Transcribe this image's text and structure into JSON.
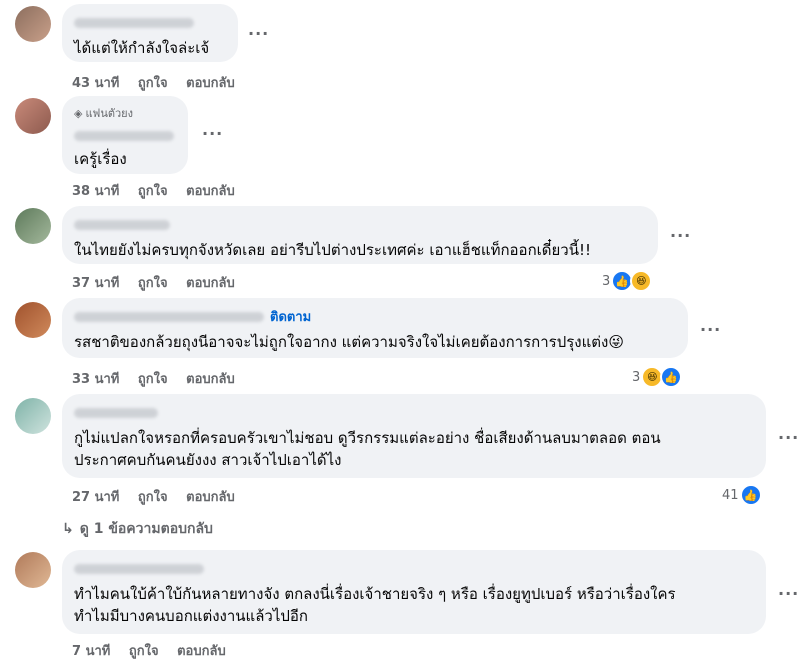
{
  "labels": {
    "like": "ถูกใจ",
    "reply": "ตอบกลับ"
  },
  "colors": {
    "bubble": "#f0f2f5",
    "meta": "#65676b",
    "link": "#0064d1",
    "like": "#1877f2",
    "haha": "#f7b928"
  },
  "comments": [
    {
      "text": "ได้แต่ให้กำลังใจล่ะเจ้",
      "time": "43 นาที"
    },
    {
      "badge": "แฟนตัวยง",
      "badge_icon": "diamond-icon",
      "text": "เครู้เรื่อง",
      "time": "38 นาที"
    },
    {
      "text": "ในไทยยังไม่ครบทุกจังหวัดเลย อย่ารีบไปต่างประเทศค่ะ เอาแฮ็ชแท็กออกเดี๋ยวนี้!!",
      "time": "37 นาที",
      "reaction_count": "3",
      "reaction_icons": [
        "like-icon",
        "haha-icon"
      ]
    },
    {
      "follow": "ติดตาม",
      "text": "รสชาติของกล้วยถุงนีอาจจะไม่ถูกใจอากง แต่ความจริงใจไม่เคยต้องการการปรุงแต่ง",
      "emoji": "😜",
      "time": "33 นาที",
      "reaction_count": "3",
      "reaction_icons": [
        "haha-icon",
        "like-icon"
      ]
    },
    {
      "text_line1": "กูไม่แปลกใจหรอกที่ครอบครัวเขาไม่ชอบ ดูวีรกรรมแต่ละอย่าง ชื่อเสียงด้านลบมาตลอด ตอน",
      "text_line2": "ประกาศคบกันคนยังงง สาวเจ้าไปเอาได้ไง",
      "time": "27 นาที",
      "reaction_count": "41",
      "reaction_icons": [
        "like-icon"
      ],
      "view_replies": "ดู 1 ข้อความตอบกลับ"
    },
    {
      "text_line1": "ทำไมคนใบ้ค้าใบ้กันหลายทางจัง ตกลงนี่เรื่องเจ้าชายจริง ๆ หรือ เรื่องยูทูปเบอร์ หรือว่าเรื่องใคร",
      "text_line2": "ทำไมมีบางคนบอกแต่งงานแล้วไปอีก",
      "time": "7 นาที"
    }
  ]
}
